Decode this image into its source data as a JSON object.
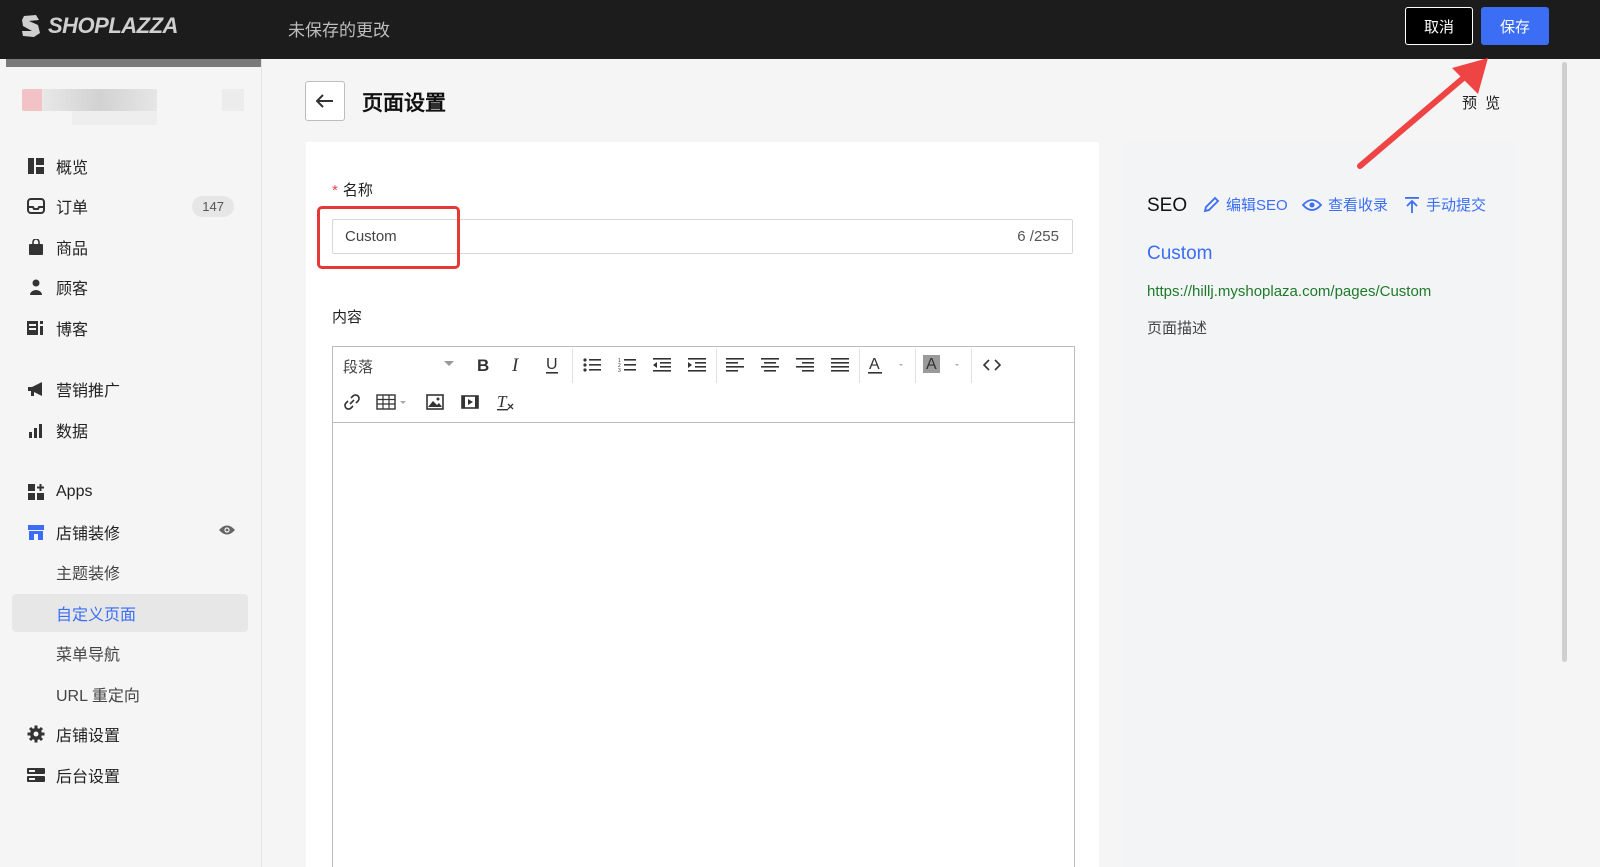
{
  "topbar": {
    "logo_text": "SHOPLAZZA",
    "status": "未保存的更改",
    "cancel_label": "取消",
    "save_label": "保存"
  },
  "sidebar": {
    "items": [
      {
        "label": "概览",
        "icon": "dashboard-icon"
      },
      {
        "label": "订单",
        "icon": "inbox-icon",
        "badge": "147"
      },
      {
        "label": "商品",
        "icon": "bag-icon"
      },
      {
        "label": "顾客",
        "icon": "person-icon"
      },
      {
        "label": "博客",
        "icon": "blog-icon"
      },
      {
        "label": "营销推广",
        "icon": "megaphone-icon"
      },
      {
        "label": "数据",
        "icon": "bar-chart-icon"
      },
      {
        "label": "Apps",
        "icon": "apps-icon"
      },
      {
        "label": "店铺装修",
        "icon": "store-icon"
      },
      {
        "label": "主题装修"
      },
      {
        "label": "自定义页面"
      },
      {
        "label": "菜单导航"
      },
      {
        "label": "URL 重定向"
      },
      {
        "label": "店铺设置",
        "icon": "gear-icon"
      },
      {
        "label": "后台设置",
        "icon": "server-icon"
      }
    ]
  },
  "header": {
    "title": "页面设置",
    "preview_label": "预 览"
  },
  "form": {
    "name_label": "名称",
    "required_mark": "*",
    "name_value": "Custom",
    "name_count": "6 /255",
    "content_label": "内容",
    "paragraph_select": "段落"
  },
  "seo": {
    "title": "SEO",
    "edit_label": "编辑SEO",
    "view_label": "查看收录",
    "submit_label": "手动提交",
    "page_title": "Custom",
    "url": "https://hillj.myshoplaza.com/pages/Custom",
    "description": "页面描述"
  },
  "colors": {
    "accent": "#3b6ef5",
    "highlight": "#e53935",
    "topbar": "#1c1c1c"
  }
}
